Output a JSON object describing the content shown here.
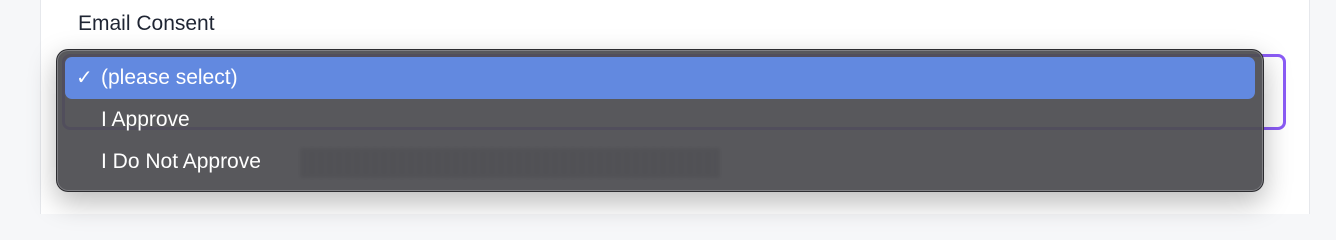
{
  "field": {
    "label": "Email Consent"
  },
  "dropdown": {
    "check_icon": "checkmark-icon",
    "options": [
      {
        "label": "(please select)",
        "selected": true
      },
      {
        "label": "I Approve",
        "selected": false
      },
      {
        "label": "I Do Not Approve",
        "selected": false
      }
    ]
  },
  "colors": {
    "selected_highlight": "#6289e0",
    "menu_background": "#4e4e52",
    "focus_border": "#8b5cf6"
  }
}
